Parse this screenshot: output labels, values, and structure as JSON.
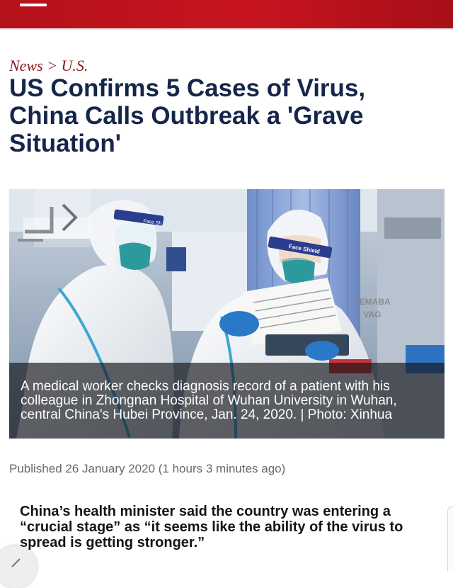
{
  "colors": {
    "brand_red": "#c8141f",
    "headline_navy": "#16264a",
    "breadcrumb_red": "#8e1616"
  },
  "header": {
    "menu_icon": "hamburger-menu-icon"
  },
  "breadcrumb": {
    "section": "News",
    "separator": ">",
    "subsection": "U.S."
  },
  "article": {
    "headline": "US Confirms 5 Cases of Virus, China Calls Outbreak a 'Grave Situation'",
    "photo": {
      "caption": "A medical worker checks diagnosis record of a patient with his colleague in Zhongnan Hospital of Wuhan University in Wuhan, central China's Hubei Province, Jan. 24, 2020. | Photo: Xinhua",
      "face_shield_text_left": "Face Sh",
      "face_shield_text_right": "Face Shield",
      "watermark_line1": "TEMABA",
      "watermark_line2": "VAG",
      "next_icon": "chevron-right-icon"
    },
    "published": "Published 26 January 2020 (1 hours 3 minutes ago)",
    "lead": "China’s health minister said the country was entering a “crucial stage” as “it seems like the ability of the virus to spread is getting stronger.”"
  },
  "fab": {
    "icon": "pencil-icon"
  }
}
